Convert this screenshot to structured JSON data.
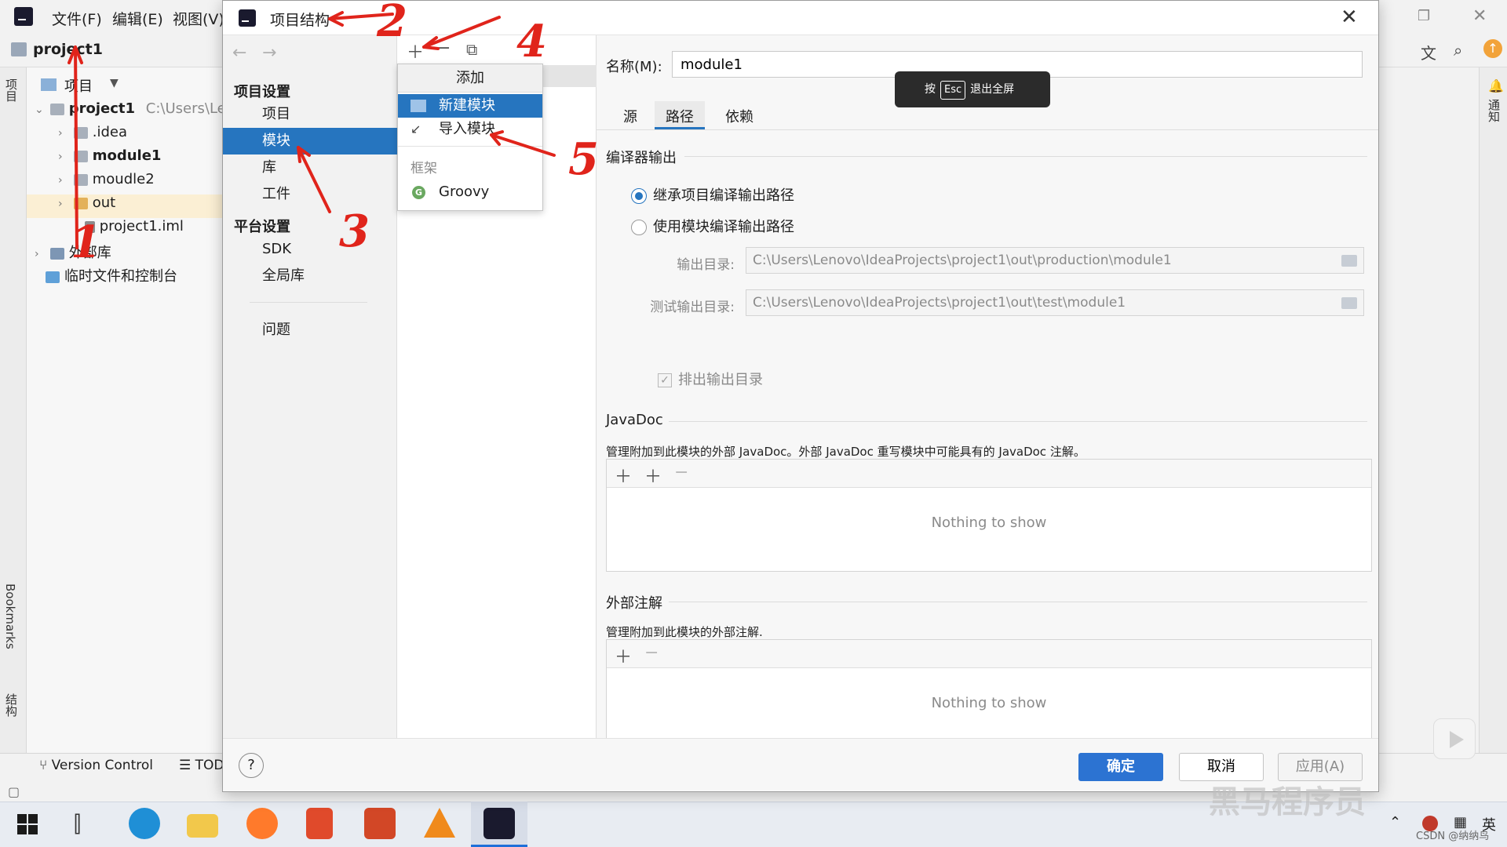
{
  "ide": {
    "menu": [
      "文件(F)",
      "编辑(E)",
      "视图(V)"
    ],
    "project_name": "project1",
    "panel_title": "项目",
    "strip_labels": [
      "项目",
      "Bookmarks",
      "结构"
    ],
    "right_strip_label": "通知",
    "tree": [
      {
        "label": "project1",
        "suffix": "C:\\Users\\Le",
        "expanded": true,
        "icon": "module-folder-icon"
      },
      {
        "label": ".idea",
        "icon": "folder-icon"
      },
      {
        "label": "module1",
        "icon": "module-folder-icon"
      },
      {
        "label": "moudle2",
        "icon": "folder-icon"
      },
      {
        "label": "out",
        "icon": "folder-orange-icon"
      },
      {
        "label": "project1.iml",
        "icon": "file-icon"
      },
      {
        "label": "外部库",
        "icon": "library-icon"
      },
      {
        "label": "临时文件和控制台",
        "icon": "scratch-icon"
      }
    ],
    "bottom_tabs": [
      "Version Control",
      "TOD"
    ]
  },
  "dialog": {
    "title": "项目结构",
    "nav": {
      "project_settings_header": "项目设置",
      "project_settings_items": [
        "项目",
        "模块",
        "库",
        "工件"
      ],
      "platform_header": "平台设置",
      "platform_items": [
        "SDK",
        "全局库"
      ],
      "problems": "问题",
      "selected": "模块"
    },
    "popup": {
      "title": "添加",
      "items": [
        "新建模块",
        "导入模块"
      ],
      "selected": "新建模块",
      "section_label": "框架",
      "framework_items": [
        "Groovy"
      ]
    },
    "content": {
      "name_label": "名称(M):",
      "name_value": "module1",
      "esc_toast": {
        "prefix": "按",
        "key": "Esc",
        "suffix": "退出全屏"
      },
      "tabs": [
        "源",
        "路径",
        "依赖"
      ],
      "active_tab": "路径",
      "compiler_output_title": "编译器输出",
      "radio_inherit": "继承项目编译输出路径",
      "radio_module": "使用模块编译输出路径",
      "output_dir_label": "输出目录:",
      "output_dir_value": "C:\\Users\\Lenovo\\IdeaProjects\\project1\\out\\production\\module1",
      "test_output_dir_label": "测试输出目录:",
      "test_output_dir_value": "C:\\Users\\Lenovo\\IdeaProjects\\project1\\out\\test\\module1",
      "exclude_label": "排出输出目录",
      "javadoc_title": "JavaDoc",
      "javadoc_desc": "管理附加到此模块的外部 JavaDoc。外部 JavaDoc 重写模块中可能具有的 JavaDoc 注解。",
      "ext_annotations_title": "外部注解",
      "ext_annotations_desc": "管理附加到此模块的外部注解.",
      "empty_text": "Nothing to show"
    },
    "footer": {
      "help": "?",
      "ok": "确定",
      "cancel": "取消",
      "apply": "应用(A)"
    }
  },
  "annotations": [
    "1",
    "2",
    "3",
    "4",
    "5"
  ],
  "overlay": {
    "watermark": "黑马程序员",
    "csdn": "CSDN @纳纳鸟"
  },
  "taskbar": {
    "tray_lang": "英"
  },
  "colors": {
    "accent": "#2675bf",
    "primary_button": "#2c73d2",
    "annotation": "#e0241b"
  }
}
